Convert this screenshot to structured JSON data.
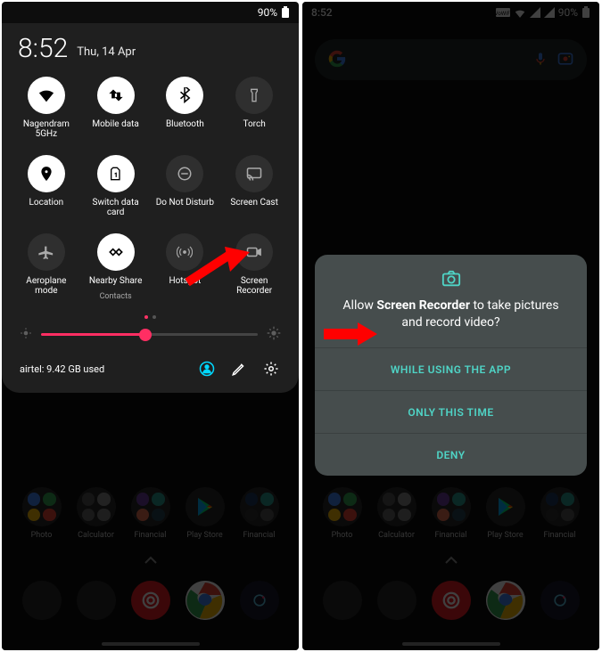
{
  "colors": {
    "accent_teal": "#4fd4c6",
    "accent_pink": "#ff2e63",
    "accent_cyan": "#00d8ff"
  },
  "left": {
    "statusbar": {
      "battery_pct": "90%"
    },
    "qs": {
      "clock": "8:52",
      "date": "Thu, 14 Apr",
      "tiles": [
        {
          "label": "Nagendram 5GHz",
          "icon": "wifi",
          "active": true
        },
        {
          "label": "Mobile data",
          "icon": "swap",
          "active": true
        },
        {
          "label": "Bluetooth",
          "icon": "bluetooth",
          "active": true
        },
        {
          "label": "Torch",
          "icon": "flashlight",
          "active": false
        },
        {
          "label": "Location",
          "icon": "location",
          "active": true
        },
        {
          "label": "Switch data card",
          "icon": "sim",
          "active": true
        },
        {
          "label": "Do Not Disturb",
          "icon": "dnd",
          "active": false
        },
        {
          "label": "Screen Cast",
          "icon": "cast",
          "active": false
        },
        {
          "label": "Aeroplane mode",
          "icon": "airplane",
          "active": false
        },
        {
          "label": "Nearby Share",
          "sublabel": "Contacts",
          "icon": "nearby",
          "active": true
        },
        {
          "label": "Hotspot",
          "icon": "hotspot",
          "active": false
        },
        {
          "label": "Screen Recorder",
          "icon": "screenrec",
          "active": false
        }
      ],
      "brightness_pct": 48,
      "data_usage": "airtel: 9.42 GB used"
    },
    "folders": [
      "Photo",
      "Calculator",
      "Financial",
      "Play Store",
      "Financial"
    ]
  },
  "right": {
    "statusbar": {
      "time": "8:52",
      "battery_pct": "90%"
    },
    "folders": [
      "Photo",
      "Calculator",
      "Financial",
      "Play Store",
      "Financial"
    ],
    "perm": {
      "title_pre": "Allow ",
      "title_bold": "Screen Recorder",
      "title_post": " to take pictures and record video?",
      "options": [
        "WHILE USING THE APP",
        "ONLY THIS TIME",
        "DENY"
      ]
    }
  }
}
